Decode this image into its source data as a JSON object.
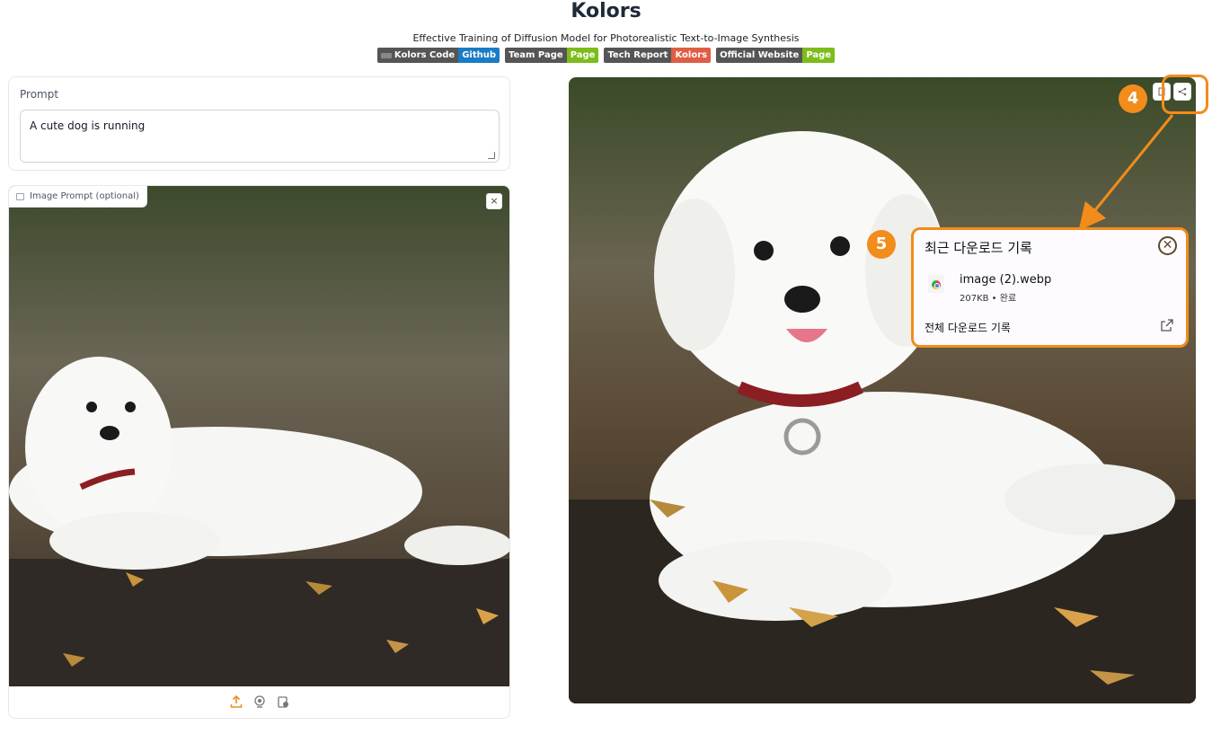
{
  "header": {
    "title": "Kolors",
    "subtitle": "Effective Training of Diffusion Model for Photorealistic Text-to-Image Synthesis"
  },
  "badges": [
    {
      "left": "Kolors Code",
      "right": "Github",
      "color": "#1a7bc6"
    },
    {
      "left": "Team Page",
      "right": "Page",
      "color": "#7cbd1a"
    },
    {
      "left": "Tech Report",
      "right": "Kolors",
      "color": "#e05d44"
    },
    {
      "left": "Official Website",
      "right": "Page",
      "color": "#7cbd1a"
    }
  ],
  "prompt": {
    "label": "Prompt",
    "value": "A cute dog is running"
  },
  "image_prompt": {
    "label": "Image Prompt (optional)",
    "close": "×"
  },
  "annotations": {
    "marker_4": "4",
    "marker_5": "5",
    "accent_color": "#f28c1b"
  },
  "download_panel": {
    "title": "최근 다운로드 기록",
    "close": "✕",
    "file_name": "image (2).webp",
    "file_meta": "207KB • 완료",
    "all_downloads": "전체 다운로드 기록"
  }
}
